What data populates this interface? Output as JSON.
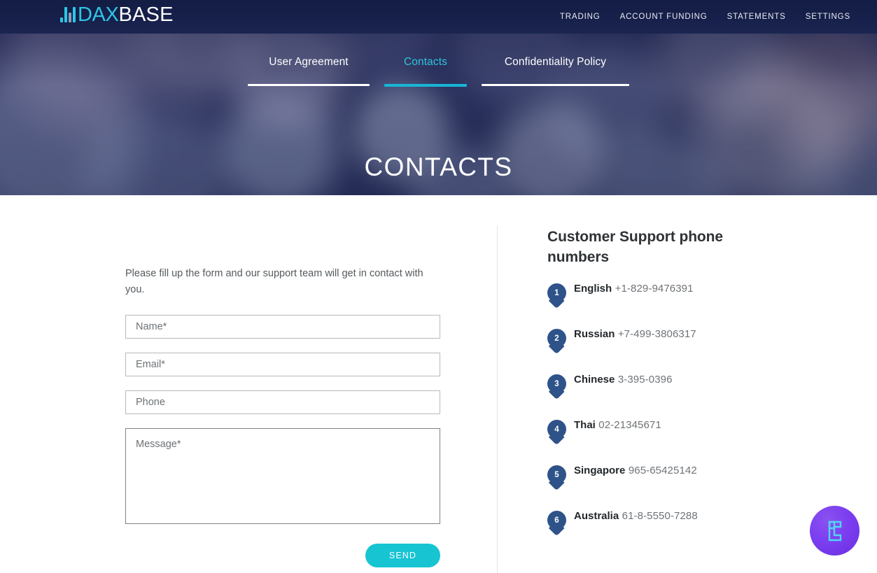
{
  "brand": {
    "mark_icon": "bars-logo-icon",
    "name_accent": "DAX",
    "name_plain": "BASE",
    "accent_color": "#2ec6e6"
  },
  "topnav": {
    "items": [
      {
        "label": "TRADING"
      },
      {
        "label": "ACCOUNT FUNDING"
      },
      {
        "label": "STATEMENTS"
      },
      {
        "label": "SETTINGS"
      }
    ]
  },
  "hero": {
    "title": "CONTACTS",
    "tabs": [
      {
        "label": "User Agreement",
        "active": false
      },
      {
        "label": "Contacts",
        "active": true
      },
      {
        "label": "Confidentiality Policy",
        "active": false
      }
    ],
    "active_tab_color": "#2fc3dd"
  },
  "form": {
    "intro": "Please fill up the form and our support team will get in contact with you.",
    "fields": [
      {
        "name": "name",
        "placeholder": "Name*",
        "value": ""
      },
      {
        "name": "email",
        "placeholder": "Email*",
        "value": ""
      },
      {
        "name": "phone",
        "placeholder": "Phone",
        "value": ""
      }
    ],
    "message": {
      "placeholder": "Message*",
      "value": ""
    },
    "submit_label": "SEND",
    "submit_color": "#16c4d2"
  },
  "support": {
    "title": "Customer Support phone numbers",
    "pin_color": "#2e5389",
    "entries": [
      {
        "index": "1",
        "language": "English",
        "phone": "+1-829-9476391"
      },
      {
        "index": "2",
        "language": "Russian",
        "phone": "+7-499-3806317"
      },
      {
        "index": "3",
        "language": "Chinese",
        "phone": "3-395-0396"
      },
      {
        "index": "4",
        "language": "Thai",
        "phone": "02-21345671"
      },
      {
        "index": "5",
        "language": "Singapore",
        "phone": "965-65425142"
      },
      {
        "index": "6",
        "language": "Australia",
        "phone": "61-8-5550-7288"
      }
    ]
  },
  "widget": {
    "icon": "chat-logo-icon",
    "bg_color": "#7b3ef0",
    "glyph_color": "#4fd6f5"
  }
}
